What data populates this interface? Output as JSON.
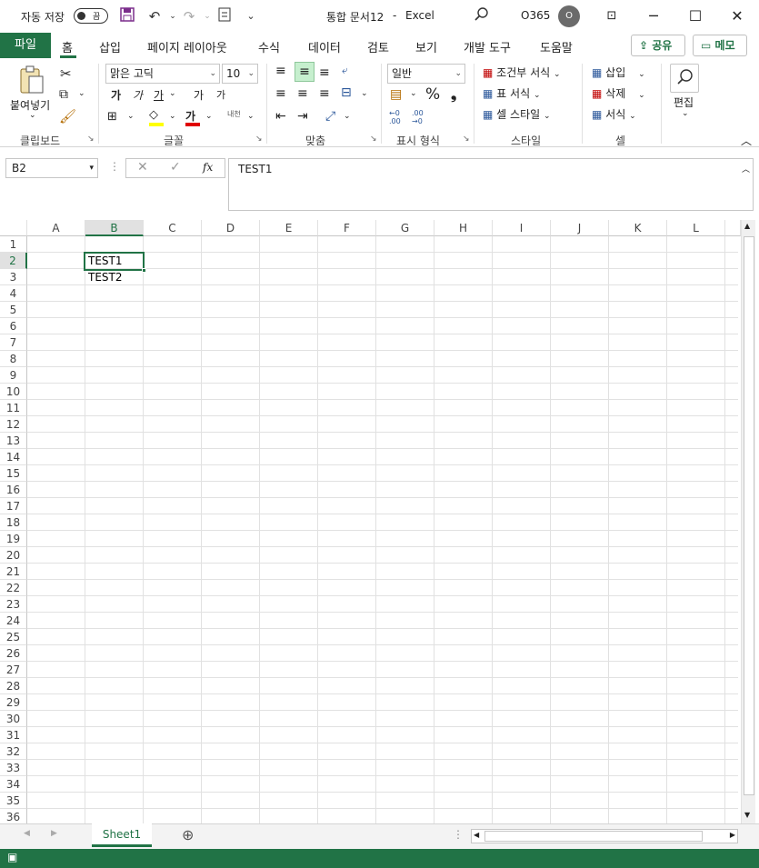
{
  "titlebar": {
    "autosave_label": "자동 저장",
    "autosave_state": "끔",
    "doc_title": "통합 문서12",
    "sep": "-",
    "app": "Excel",
    "account": "O365",
    "avatar_initial": "O"
  },
  "tabs": {
    "file": "파일",
    "items": [
      "홈",
      "삽입",
      "페이지 레이아웃",
      "수식",
      "데이터",
      "검토",
      "보기",
      "개발 도구",
      "도움말"
    ],
    "share": "공유",
    "comment": "메모"
  },
  "ribbon": {
    "clipboard": {
      "paste": "붙여넣기",
      "label": "클립보드"
    },
    "font": {
      "name": "맑은 고딕",
      "size": "10",
      "bold": "가",
      "italic": "가",
      "underline": "가",
      "grow": "가",
      "shrink": "가",
      "phonetic": "내천",
      "label": "글꼴"
    },
    "align": {
      "label": "맞춤"
    },
    "number": {
      "format": "일반",
      "label": "표시 형식"
    },
    "styles": {
      "conditional": "조건부 서식",
      "table": "표 서식",
      "cell": "셀 스타일",
      "label": "스타일"
    },
    "cells": {
      "insert": "삽입",
      "delete": "삭제",
      "format": "서식",
      "label": "셀"
    },
    "editing": {
      "label": "편집"
    }
  },
  "formula_bar": {
    "name_box": "B2",
    "content": "TEST1"
  },
  "grid": {
    "columns": [
      "A",
      "B",
      "C",
      "D",
      "E",
      "F",
      "G",
      "H",
      "I",
      "J",
      "K",
      "L"
    ],
    "rows": [
      "1",
      "2",
      "3",
      "4",
      "5",
      "6",
      "7",
      "8",
      "9",
      "10",
      "11",
      "12",
      "13",
      "14",
      "15",
      "16",
      "17",
      "18",
      "19",
      "20",
      "21",
      "22",
      "23",
      "24",
      "25",
      "26",
      "27",
      "28",
      "29",
      "30",
      "31",
      "32",
      "33",
      "34",
      "35",
      "36"
    ],
    "active_cell": "B2",
    "cells": {
      "B2": "TEST1",
      "B3": "TEST2"
    }
  },
  "sheets": {
    "active": "Sheet1"
  },
  "colors": {
    "accent": "#217346"
  }
}
